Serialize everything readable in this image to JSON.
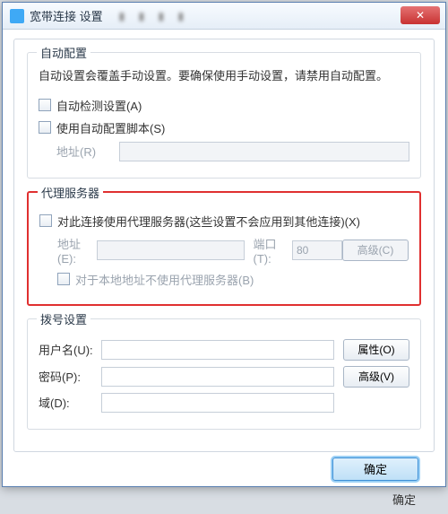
{
  "window": {
    "title": "宽带连接 设置",
    "close_icon": "✕"
  },
  "auto_config": {
    "legend": "自动配置",
    "note": "自动设置会覆盖手动设置。要确保使用手动设置，请禁用自动配置。",
    "detect_label": "自动检测设置(A)",
    "script_label": "使用自动配置脚本(S)",
    "address_label": "地址(R)",
    "address_value": ""
  },
  "proxy": {
    "legend": "代理服务器",
    "use_label": "对此连接使用代理服务器(这些设置不会应用到其他连接)(X)",
    "address_label": "地址(E):",
    "address_value": "",
    "port_label": "端口(T):",
    "port_value": "80",
    "advanced_btn": "高级(C)",
    "bypass_label": "对于本地地址不使用代理服务器(B)"
  },
  "dialup": {
    "legend": "拨号设置",
    "user_label": "用户名(U):",
    "user_value": "",
    "pass_label": "密码(P):",
    "pass_value": "",
    "domain_label": "域(D):",
    "domain_value": "",
    "props_btn": "属性(O)",
    "adv_btn": "高级(V)"
  },
  "footer": {
    "ok_btn": "确定",
    "trailing_label": "确定"
  }
}
